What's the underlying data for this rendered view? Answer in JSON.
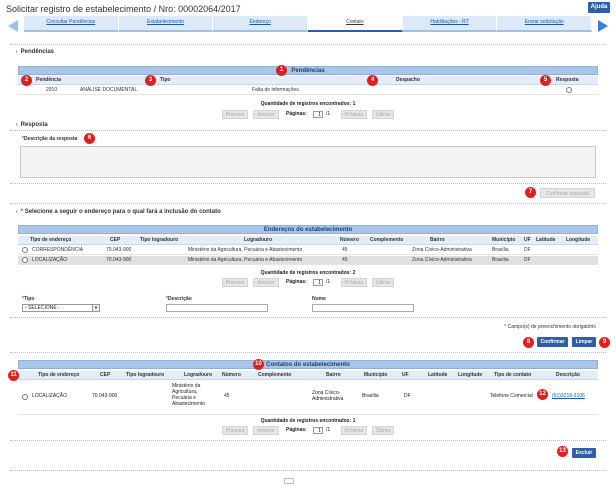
{
  "header": {
    "title": "Solicitar registro de estabelecimento / Nro: 00002064/2017",
    "help_label": "Ajuda"
  },
  "wizard": {
    "tabs": [
      {
        "label": "Consultar Pendências"
      },
      {
        "label": "Estabelecimento"
      },
      {
        "label": "Endereço"
      },
      {
        "label": "Contato"
      },
      {
        "label": "Habilitações - RT"
      },
      {
        "label": "Enviar solicitação"
      }
    ],
    "active_index": 3
  },
  "pendencias": {
    "section_label": "Pendências",
    "table_title": "Pendências",
    "columns": [
      "Pendência",
      "Tipo",
      "Despacho",
      "Resposta"
    ],
    "rows": [
      {
        "pendencia": "2910",
        "tipo": "ANÁLISE DOCUMENTAL",
        "despacho": "Falta de informações."
      }
    ],
    "records_label": "Quantidade de registros encontrados:",
    "records_count": "1"
  },
  "pager": {
    "first": "Primeira",
    "prev": "Anterior",
    "pages_label": "Páginas:",
    "page": "1",
    "total": "/1",
    "next": "Próxima",
    "last": "Última"
  },
  "resposta": {
    "section_label": "Resposta",
    "field_label": "Descrição da resposta",
    "confirm_label": "Confirmar resposta"
  },
  "enderecos": {
    "prompt": "Selecione a seguir o endereço para o qual fará a inclusão do contato",
    "table_title": "Endereços do estabelecimento",
    "columns": [
      "Tipo de endereço",
      "CEP",
      "Tipo logradouro",
      "Logradouro",
      "Número",
      "Complemento",
      "Bairro",
      "Município",
      "UF",
      "Latitude",
      "Longitude"
    ],
    "rows": [
      {
        "tipo": "CORRESPONDÊNCIA",
        "cep": "70.043-900",
        "tipo_logradouro": "",
        "logradouro": "Ministério da Agricultura, Pecuária e Abastecimento",
        "numero": "45",
        "complemento": "",
        "bairro": "Zona Cívico-Administrativa",
        "municipio": "Brasília",
        "uf": "DF",
        "latitude": "",
        "longitude": ""
      },
      {
        "tipo": "LOCALIZAÇÃO",
        "cep": "70.043-900",
        "tipo_logradouro": "",
        "logradouro": "Ministério da Agricultura, Pecuária e Abastecimento",
        "numero": "45",
        "complemento": "",
        "bairro": "Zona Cívico-Administrativa",
        "municipio": "Brasília",
        "uf": "DF",
        "latitude": "",
        "longitude": ""
      }
    ],
    "records_label": "Quantidade de registros encontrados:",
    "records_count": "2"
  },
  "contato_form": {
    "tipo_label": "Tipo",
    "tipo_value": "- SELECIONE -",
    "descricao_label": "Descrição",
    "nome_label": "Nome",
    "required_note": "* Campo(s) de preenchimento obrigatório",
    "confirm_label": "Confirmar",
    "clear_label": "Limpar"
  },
  "contatos": {
    "table_title": "Contatos do estabelecimento",
    "columns": [
      "Tipo de endereço",
      "CEP",
      "Tipo logradouro",
      "Logradouro",
      "Número",
      "Complemento",
      "Bairro",
      "Município",
      "UF",
      "Latitude",
      "Longitude",
      "Tipo de contato",
      "Descrição"
    ],
    "rows": [
      {
        "tipo": "LOCALIZAÇÃO",
        "cep": "70.043-900",
        "tipo_logradouro": "",
        "logradouro_l1": "Ministério da",
        "logradouro_l2": "Agricultura,",
        "logradouro_l3": "Pecuária e",
        "logradouro_l4": "Abastecimento",
        "numero": "45",
        "complemento": "",
        "bairro_l1": "Zona Cívico-",
        "bairro_l2": "Administrativa",
        "municipio": "Brasília",
        "uf": "DF",
        "latitude": "",
        "longitude": "",
        "tipo_contato": "Telefone Comercial",
        "descricao": "(61)3218-3106"
      }
    ],
    "records_label": "Quantidade de registros encontrados:",
    "records_count": "1",
    "delete_label": "Excluir"
  },
  "badges": [
    "1",
    "2",
    "3",
    "4",
    "5",
    "6",
    "7",
    "8",
    "9",
    "10",
    "11",
    "12",
    "13"
  ]
}
